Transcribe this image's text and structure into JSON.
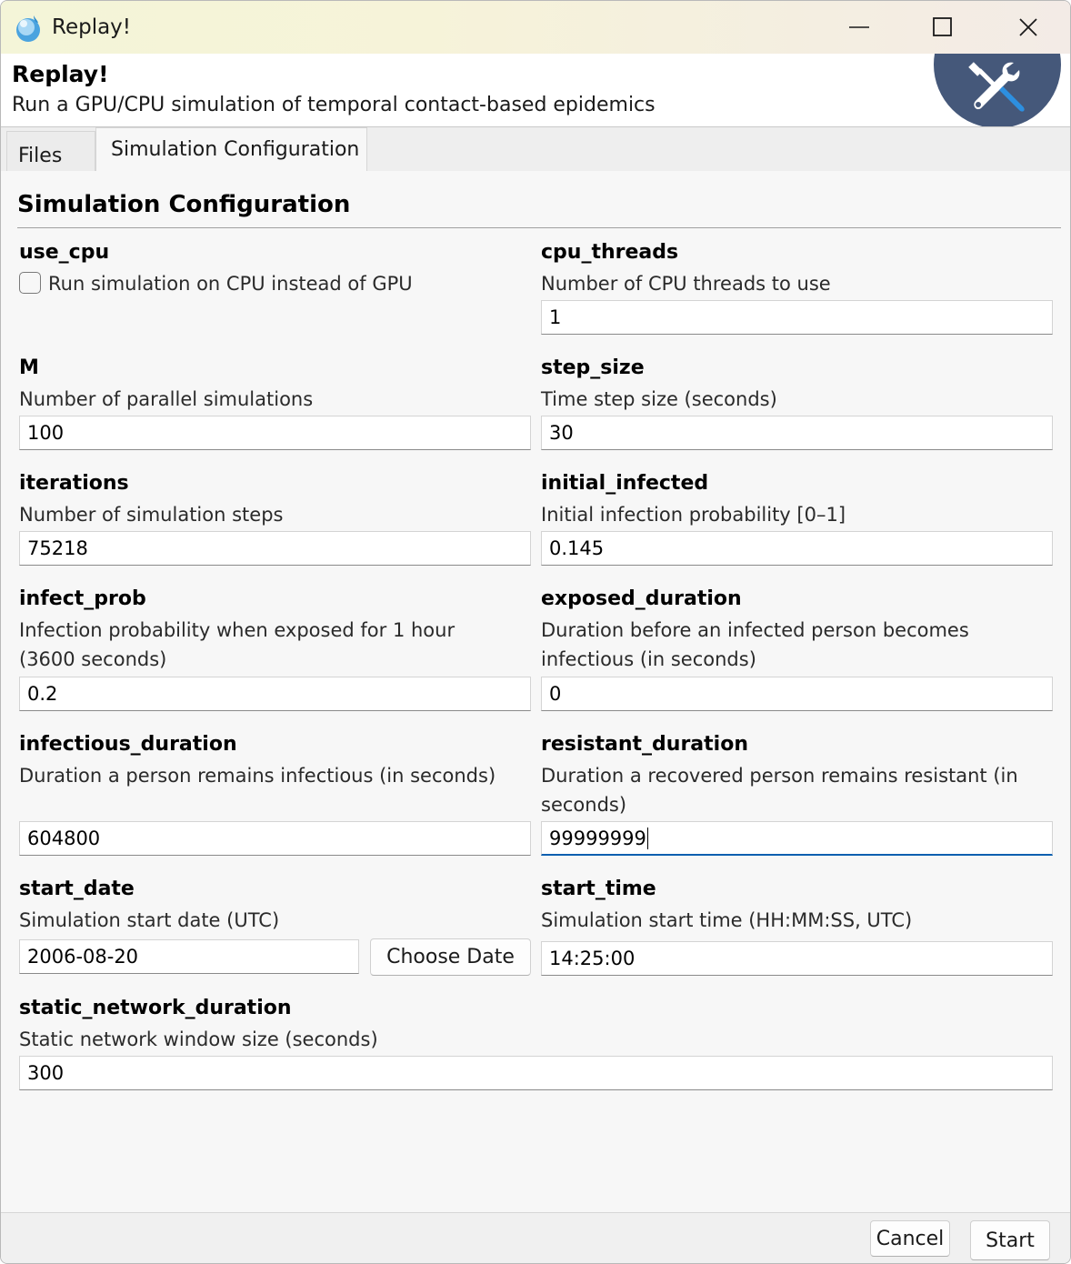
{
  "window": {
    "title": "Replay!",
    "app_icon": "droplet-icon",
    "controls": [
      "minimize-icon",
      "maximize-icon",
      "close-icon"
    ]
  },
  "banner": {
    "title": "Replay!",
    "subtitle": "Run a GPU/CPU simulation of temporal contact-based epidemics",
    "logo_icon": "tools-icon"
  },
  "tabs": [
    {
      "label": "Files",
      "selected": false
    },
    {
      "label": "Simulation Configuration",
      "selected": true
    }
  ],
  "section": {
    "title": "Simulation Configuration"
  },
  "fields": {
    "use_cpu": {
      "label": "use_cpu",
      "checkbox_label": "Run simulation on CPU instead of GPU",
      "checked": false
    },
    "cpu_threads": {
      "label": "cpu_threads",
      "description": "Number of CPU threads to use",
      "value": "1"
    },
    "M": {
      "label": "M",
      "description": "Number of parallel simulations",
      "value": "100"
    },
    "step_size": {
      "label": "step_size",
      "description": "Time step size (seconds)",
      "value": "30"
    },
    "iterations": {
      "label": "iterations",
      "description": "Number of simulation steps",
      "value": "75218"
    },
    "initial_infected": {
      "label": "initial_infected",
      "description": "Initial infection probability [0–1]",
      "value": "0.145"
    },
    "infect_prob": {
      "label": "infect_prob",
      "description_line1": "Infection probability when exposed for 1 hour",
      "description_line2": "(3600 seconds)",
      "value": "0.2"
    },
    "exposed_duration": {
      "label": "exposed_duration",
      "description_line1": "Duration before an infected person becomes",
      "description_line2": "infectious (in seconds)",
      "value": "0"
    },
    "infectious_duration": {
      "label": "infectious_duration",
      "description": "Duration a person remains infectious (in seconds)",
      "value": "604800"
    },
    "resistant_duration": {
      "label": "resistant_duration",
      "description_line1": "Duration a recovered person remains resistant (in",
      "description_line2": "seconds)",
      "value": "99999999"
    },
    "start_date": {
      "label": "start_date",
      "description": "Simulation start date (UTC)",
      "value": "2006-08-20",
      "button_label": "Choose Date"
    },
    "start_time": {
      "label": "start_time",
      "description": "Simulation start time (HH:MM:SS, UTC)",
      "value": "14:25:00"
    },
    "static_network_duration": {
      "label": "static_network_duration",
      "description": "Static network window size (seconds)",
      "value": "300"
    }
  },
  "footer": {
    "cancel_label": "Cancel",
    "start_label": "Start"
  }
}
